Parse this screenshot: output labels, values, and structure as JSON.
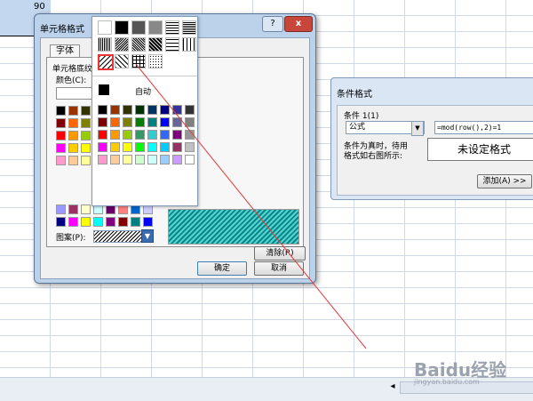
{
  "sheet": {
    "cell_value": "90"
  },
  "format_dialog": {
    "title": "单元格格式",
    "help_label": "?",
    "close_label": "x",
    "tab_font": "字体",
    "section_label": "单元格底纹",
    "color_label": "颜色(C):",
    "pattern_label": "图案(P):",
    "clear_button": "清除(R)",
    "ok_button": "确定",
    "cancel_button": "取消",
    "palette_colors": [
      "#000000",
      "#993300",
      "#333300",
      "#003300",
      "#003366",
      "#000080",
      "#333399",
      "#333333",
      "#800000",
      "#ff6600",
      "#808000",
      "#008000",
      "#008080",
      "#0000ff",
      "#666699",
      "#808080",
      "#ff0000",
      "#ff9900",
      "#99cc00",
      "#339966",
      "#33cccc",
      "#3366ff",
      "#800080",
      "#969696",
      "#ff00ff",
      "#ffcc00",
      "#ffff00",
      "#00ff00",
      "#00ffff",
      "#00ccff",
      "#993366",
      "#c0c0c0",
      "#ff99cc",
      "#ffcc99",
      "#ffff99",
      "#ccffcc",
      "#ccffff",
      "#99ccff",
      "#cc99ff",
      "#ffffff"
    ],
    "extra_colors": [
      "#9999ff",
      "#993366",
      "#ffffcc",
      "#ccffff",
      "#660066",
      "#ff8080",
      "#0066cc",
      "#ccccff",
      "#000080",
      "#ff00ff",
      "#ffff00",
      "#00ffff",
      "#800080",
      "#800000",
      "#008080",
      "#0000ff"
    ]
  },
  "pattern_popup": {
    "auto_label": "自动"
  },
  "cond_dialog": {
    "title": "条件格式",
    "condition_label": "条件 1(1)",
    "type_value": "公式",
    "formula": "=mod(row(),2)=1",
    "desc_line1": "条件为真时，待用",
    "desc_line2": "格式如右图所示:",
    "preview_text": "未设定格式",
    "add_button": "添加(A) >>"
  },
  "watermark": {
    "brand": "Baidu经验",
    "url": "jingyan.baidu.com"
  }
}
